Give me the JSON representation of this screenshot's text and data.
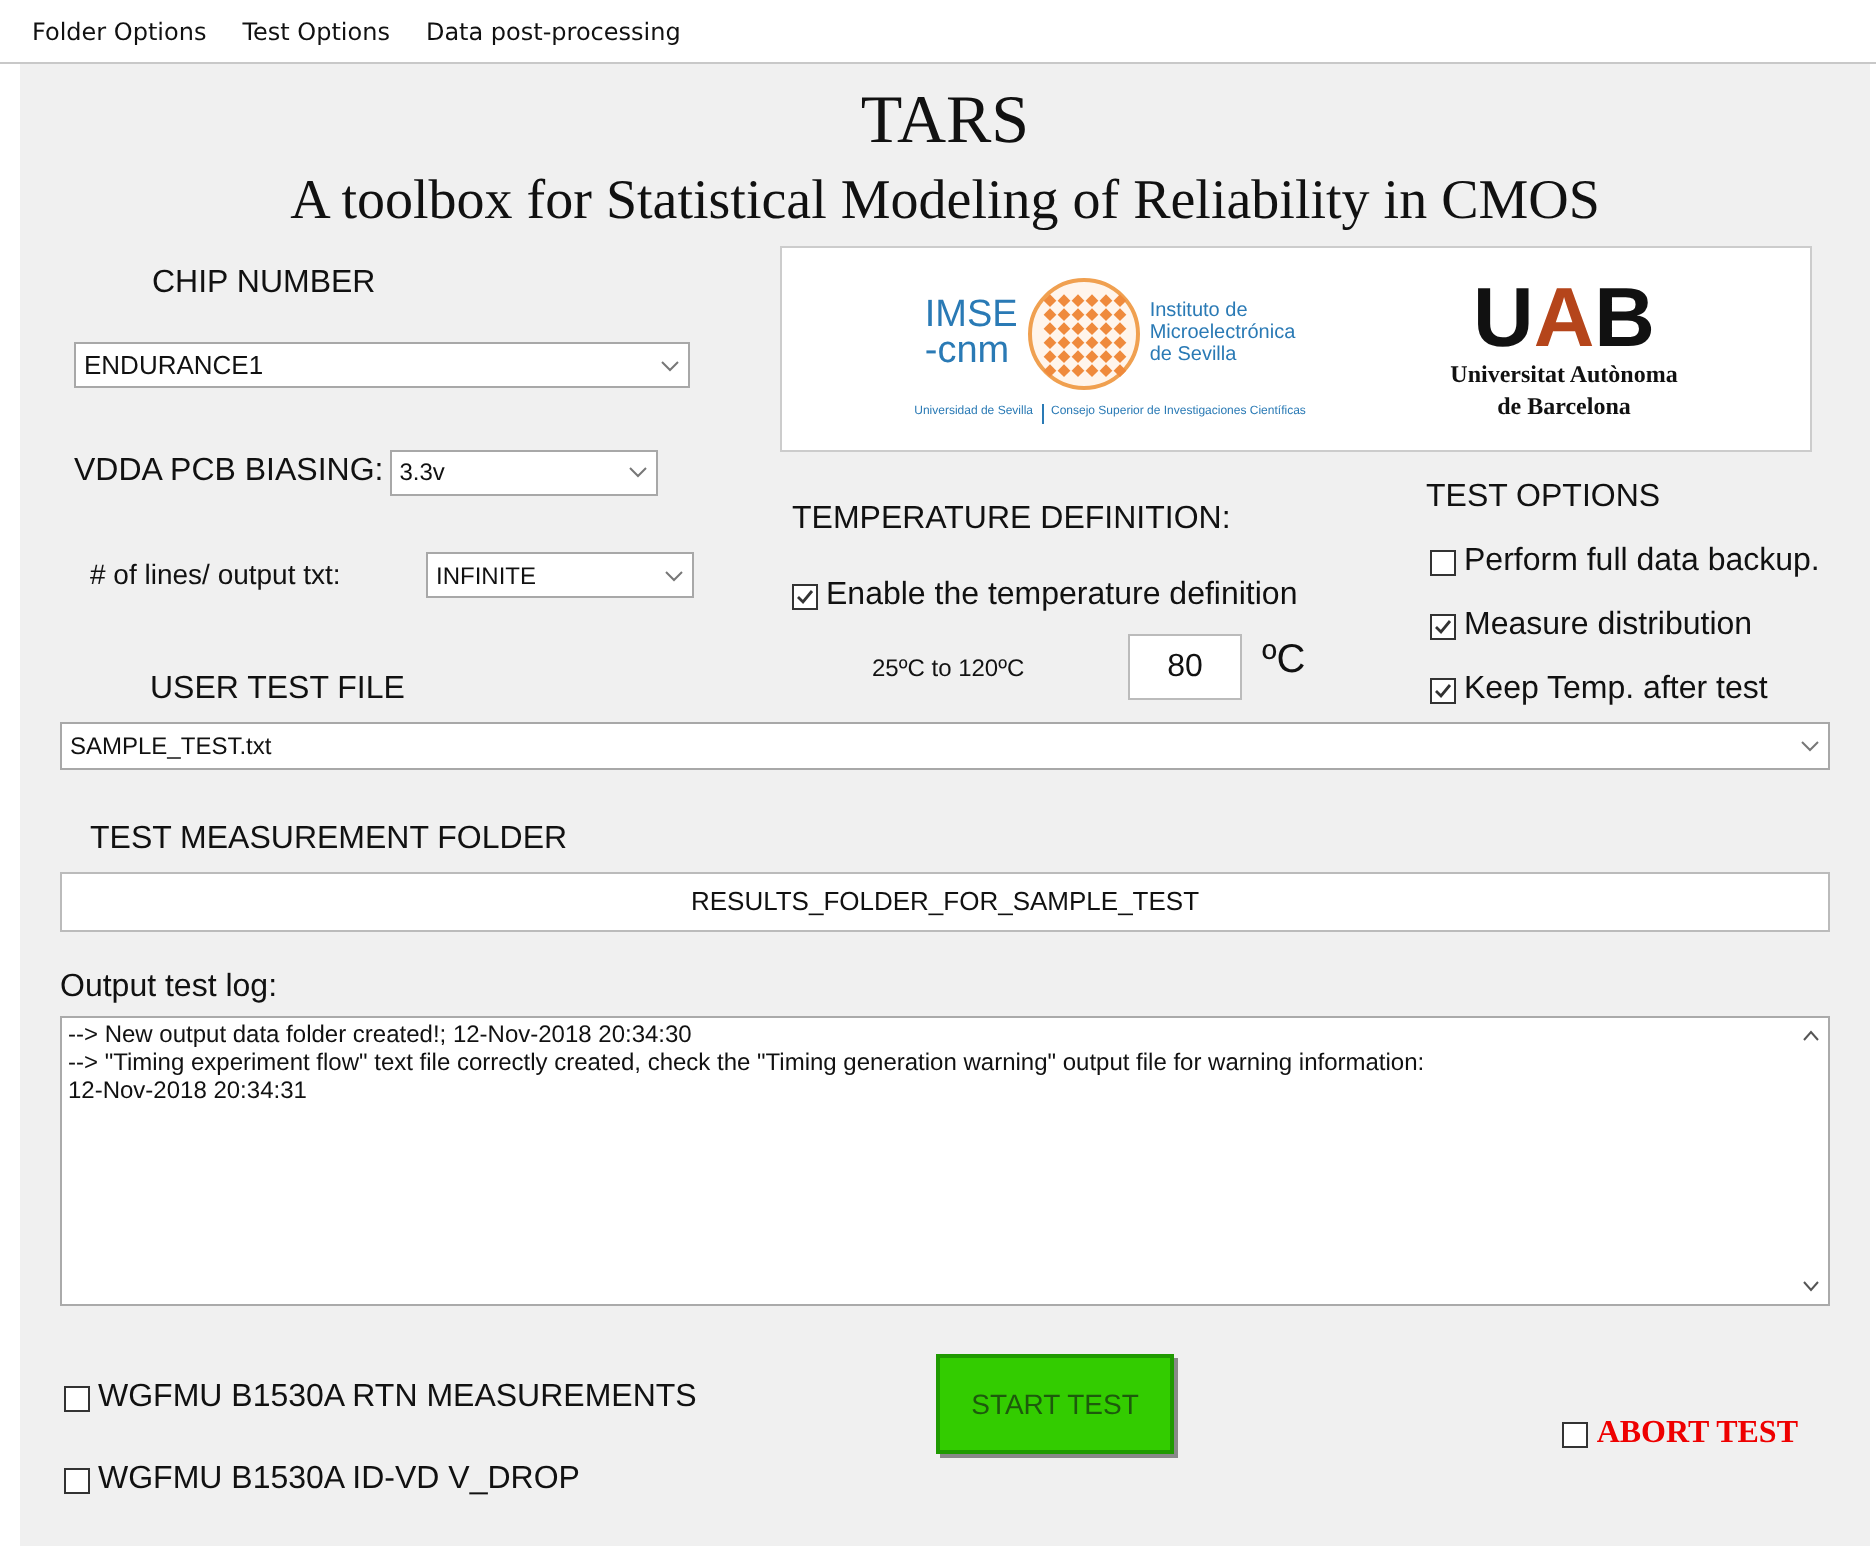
{
  "menu": [
    "Folder Options",
    "Test Options",
    "Data post-processing"
  ],
  "title": "TARS",
  "subtitle": "A toolbox for Statistical Modeling of Reliability in CMOS",
  "chip_number": {
    "label": "CHIP NUMBER",
    "value": "ENDURANCE1"
  },
  "vdda": {
    "label": "VDDA PCB BIASING:",
    "value": "3.3v"
  },
  "lines": {
    "label": "# of lines/ output txt:",
    "value": "INFINITE"
  },
  "logos": {
    "imse_top": "IMSE",
    "imse_bottom": "-cnm",
    "imse_name": [
      "Instituto de",
      "Microelectrónica",
      "de Sevilla"
    ],
    "imse_footer": [
      "Universidad de Sevilla",
      "Consejo Superior de Investigaciones Científicas"
    ],
    "uab_letters": [
      "U",
      "A",
      "B"
    ],
    "uab_name": [
      "Universitat Autònoma",
      "de Barcelona"
    ]
  },
  "temperature": {
    "heading": "TEMPERATURE DEFINITION:",
    "enable": {
      "label": "Enable the temperature definition",
      "checked": true
    },
    "range": "25ºC to 120ºC",
    "value": "80",
    "unit": "ºC"
  },
  "test_options": {
    "heading": "TEST OPTIONS",
    "options": [
      {
        "label": "Perform full data backup.",
        "checked": false
      },
      {
        "label": "Measure distribution",
        "checked": true
      },
      {
        "label": "Keep Temp. after test",
        "checked": true
      }
    ]
  },
  "user_test_file": {
    "label": "USER TEST FILE",
    "value": "SAMPLE_TEST.txt"
  },
  "measurement_folder": {
    "label": "TEST MEASUREMENT FOLDER",
    "value": "RESULTS_FOLDER_FOR_SAMPLE_TEST"
  },
  "log": {
    "label": "Output test log:",
    "lines": [
      "--> New output data folder created!; 12-Nov-2018 20:34:30",
      "--> \"Timing experiment flow\" text file correctly created, check the \"Timing generation warning\" output file for warning information:",
      "12-Nov-2018 20:34:31"
    ]
  },
  "measurements": [
    {
      "label": "WGFMU B1530A RTN MEASUREMENTS",
      "checked": false
    },
    {
      "label": "WGFMU B1530A ID-VD V_DROP",
      "checked": false
    }
  ],
  "start_button": {
    "label": "START TEST",
    "disabled": true
  },
  "abort": {
    "label": "ABORT TEST",
    "checked": false
  }
}
